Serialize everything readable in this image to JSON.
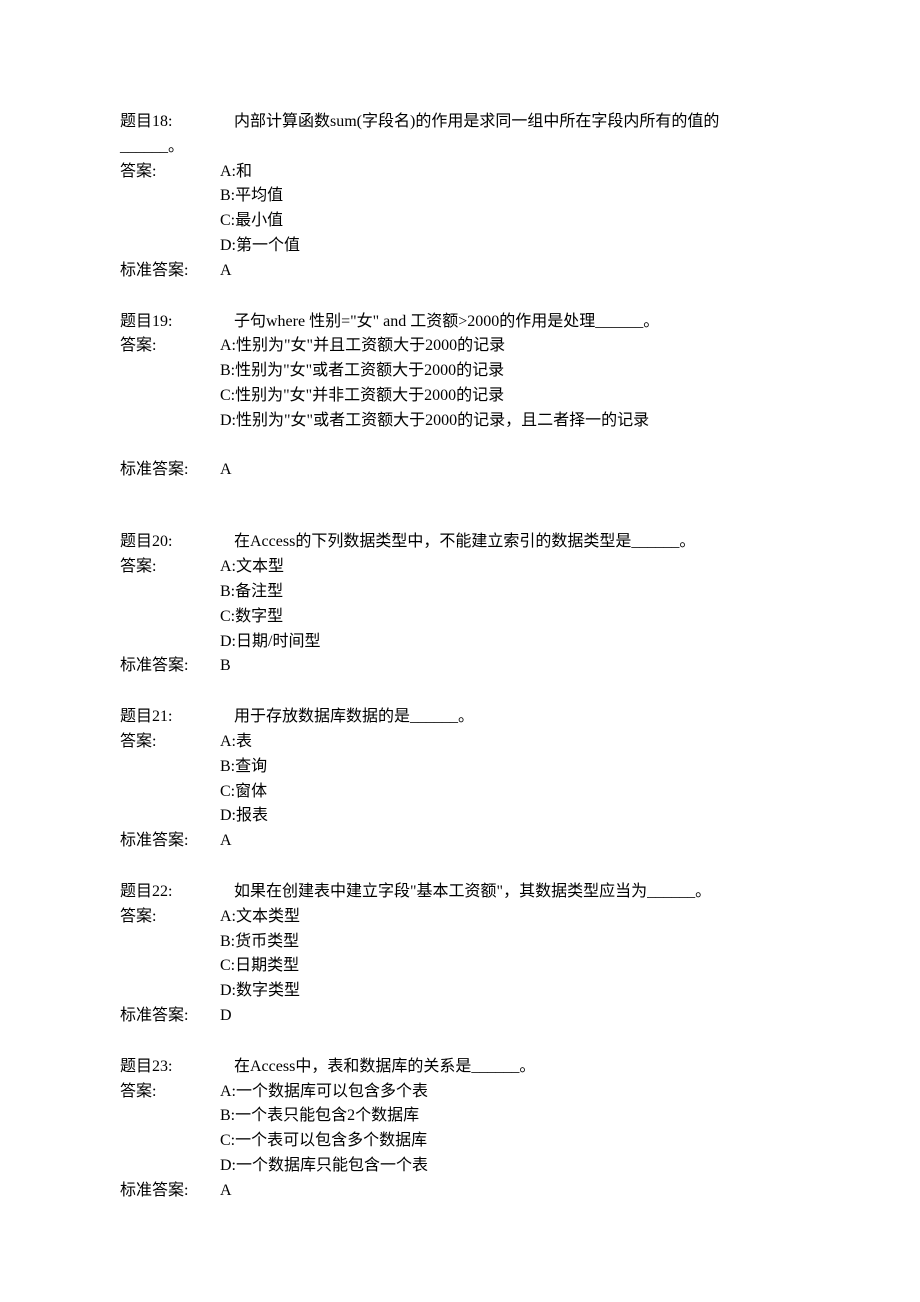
{
  "labels": {
    "answer": "答案:",
    "standard": "标准答案:"
  },
  "questions": [
    {
      "id": "q18",
      "title_label": "题目18:",
      "question_line1": "内部计算函数sum(字段名)的作用是求同一组中所在字段内所有的值的",
      "question_line2": "______。",
      "options": [
        "A:和",
        "B:平均值",
        "C:最小值",
        "D:第一个值"
      ],
      "standard_answer": "A",
      "extra_gap": false,
      "two_line_question": true
    },
    {
      "id": "q19",
      "title_label": "题目19:",
      "question_line1": "子句where 性别=\"女\" and 工资额>2000的作用是处理______。",
      "question_line2": "",
      "options": [
        "A:性别为\"女\"并且工资额大于2000的记录",
        "B:性别为\"女\"或者工资额大于2000的记录",
        "C:性别为\"女\"并非工资额大于2000的记录",
        "D:性别为\"女\"或者工资额大于2000的记录，且二者择一的记录"
      ],
      "standard_answer": "A",
      "extra_gap": true,
      "two_line_question": false
    },
    {
      "id": "q20",
      "title_label": "题目20:",
      "question_line1": "在Access的下列数据类型中，不能建立索引的数据类型是______。",
      "question_line2": "",
      "options": [
        "A:文本型",
        "B:备注型",
        "C:数字型",
        "D:日期/时间型"
      ],
      "standard_answer": "B",
      "extra_gap": false,
      "two_line_question": false
    },
    {
      "id": "q21",
      "title_label": "题目21:",
      "question_line1": "用于存放数据库数据的是______。",
      "question_line2": "",
      "options": [
        "A:表",
        "B:查询",
        "C:窗体",
        "D:报表"
      ],
      "standard_answer": "A",
      "extra_gap": false,
      "two_line_question": false
    },
    {
      "id": "q22",
      "title_label": "题目22:",
      "question_line1": "如果在创建表中建立字段\"基本工资额\"，其数据类型应当为______。",
      "question_line2": "",
      "options": [
        "A:文本类型",
        "B:货币类型",
        "C:日期类型",
        "D:数字类型"
      ],
      "standard_answer": "D",
      "extra_gap": false,
      "two_line_question": false
    },
    {
      "id": "q23",
      "title_label": "题目23:",
      "question_line1": "在Access中，表和数据库的关系是______。",
      "question_line2": "",
      "options": [
        "A:一个数据库可以包含多个表",
        "B:一个表只能包含2个数据库",
        "C:一个表可以包含多个数据库",
        "D:一个数据库只能包含一个表"
      ],
      "standard_answer": "A",
      "extra_gap": false,
      "two_line_question": false
    }
  ]
}
